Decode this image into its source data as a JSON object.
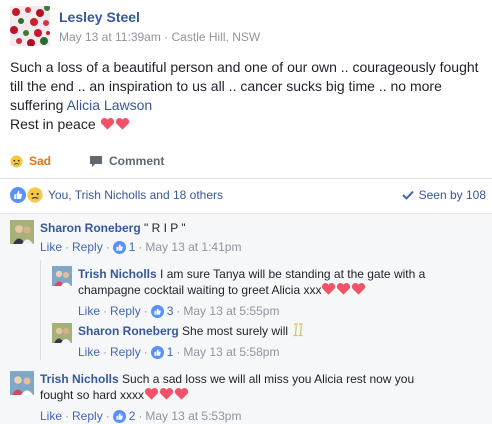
{
  "post": {
    "author": "Lesley Steel",
    "timestamp": "May 13 at 11:39am",
    "location_sep": " · ",
    "location": "Castle Hill, NSW",
    "body_text": "Such a loss of a beautiful person and one of our own .. courageously fought till the end .. an inspiration to us all .. cancer sucks big time .. no more suffering",
    "tagged_name": "Alicia Lawson",
    "closing": "Rest in peace",
    "heart_color": "#f25268"
  },
  "actions": {
    "sad_label": "Sad",
    "comment_label": "Comment",
    "sad_color": "#e9710f"
  },
  "reactions": {
    "summary": "You, Trish Nicholls and 18 others",
    "seen": "Seen by 108"
  },
  "comments": [
    {
      "name": "Sharon Roneberg",
      "text": " \" R I P \"",
      "like": "Like",
      "reply": "Reply",
      "likes": "1",
      "time": "May 13 at 1:41pm"
    },
    {
      "name": "Trish Nicholls",
      "text": " I am sure Tanya will be standing at the gate with a champagne cocktail waiting to greet Alicia xxx",
      "like": "Like",
      "reply": "Reply",
      "likes": "3",
      "time": "May 13 at 5:55pm"
    },
    {
      "name": "Sharon Roneberg",
      "text": " She most surely will",
      "like": "Like",
      "reply": "Reply",
      "likes": "1",
      "time": "May 13 at 5:58pm"
    },
    {
      "name": "Trish Nicholls",
      "text": " Such a sad loss we will all miss you Alicia rest now you fought so hard xxxx",
      "like": "Like",
      "reply": "Reply",
      "likes": "2",
      "time": "May 13 at 5:53pm"
    }
  ],
  "colors": {
    "link_blue": "#365899",
    "action_blue": "#4267b2",
    "meta_gray": "#90949c",
    "like_blue": "#5890ff"
  }
}
